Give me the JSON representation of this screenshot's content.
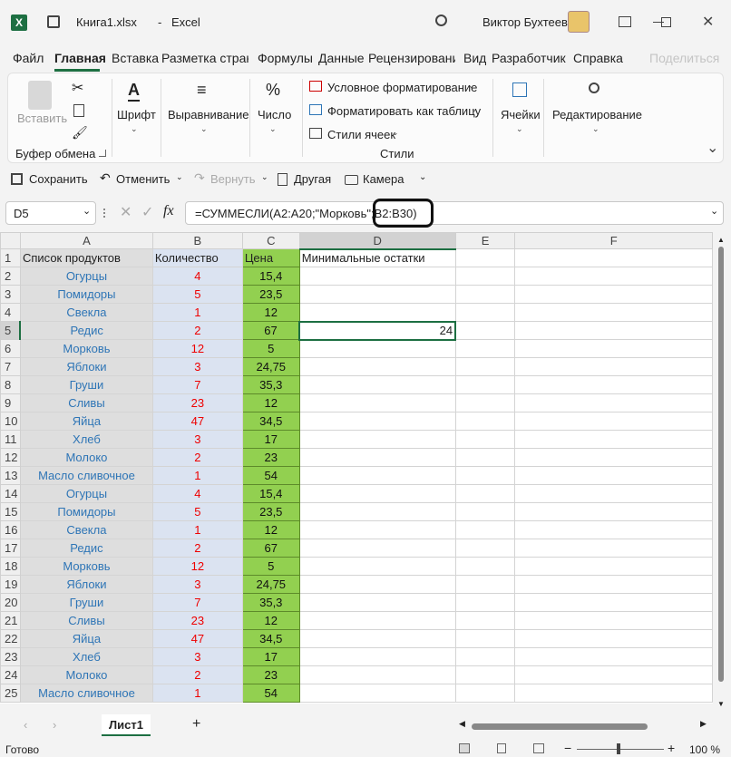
{
  "title": {
    "filename": "Книга1.xlsx",
    "separator": "-",
    "app": "Excel",
    "user": "Виктор Бухтеев"
  },
  "tabs": [
    "Файл",
    "Главная",
    "Вставка",
    "Разметка страни",
    "Формулы",
    "Данные",
    "Рецензировани",
    "Вид",
    "Разработчик",
    "Справка"
  ],
  "share_label": "Поделиться",
  "ribbon": {
    "paste": "Вставить",
    "clipboard": "Буфер обмена",
    "font": "Шрифт",
    "align": "Выравнивание",
    "number": "Число",
    "cond_format": "Условное форматирование",
    "format_table": "Форматировать как таблицу",
    "cell_styles": "Стили ячеек",
    "styles": "Стили",
    "cells": "Ячейки",
    "editing": "Редактирование"
  },
  "qat": {
    "save": "Сохранить",
    "undo": "Отменить",
    "redo": "Вернуть",
    "other": "Другая",
    "camera": "Камера"
  },
  "namebox": "D5",
  "formula": "=СУММЕСЛИ(A2:A20;\"Морковь\";B2:B30)",
  "columns": [
    "A",
    "B",
    "C",
    "D",
    "E",
    "F"
  ],
  "header_row": {
    "a": "Список продуктов",
    "b": "Количество",
    "c": "Цена",
    "d": "Минимальные остатки"
  },
  "rows": [
    [
      "Огурцы",
      "4",
      "15,4"
    ],
    [
      "Помидоры",
      "5",
      "23,5"
    ],
    [
      "Свекла",
      "1",
      "12"
    ],
    [
      "Редис",
      "2",
      "67"
    ],
    [
      "Морковь",
      "12",
      "5"
    ],
    [
      "Яблоки",
      "3",
      "24,75"
    ],
    [
      "Груши",
      "7",
      "35,3"
    ],
    [
      "Сливы",
      "23",
      "12"
    ],
    [
      "Яйца",
      "47",
      "34,5"
    ],
    [
      "Хлеб",
      "3",
      "17"
    ],
    [
      "Молоко",
      "2",
      "23"
    ],
    [
      "Масло сливочное",
      "1",
      "54"
    ],
    [
      "Огурцы",
      "4",
      "15,4"
    ],
    [
      "Помидоры",
      "5",
      "23,5"
    ],
    [
      "Свекла",
      "1",
      "12"
    ],
    [
      "Редис",
      "2",
      "67"
    ],
    [
      "Морковь",
      "12",
      "5"
    ],
    [
      "Яблоки",
      "3",
      "24,75"
    ],
    [
      "Груши",
      "7",
      "35,3"
    ],
    [
      "Сливы",
      "23",
      "12"
    ],
    [
      "Яйца",
      "47",
      "34,5"
    ],
    [
      "Хлеб",
      "3",
      "17"
    ],
    [
      "Молоко",
      "2",
      "23"
    ],
    [
      "Масло сливочное",
      "1",
      "54"
    ]
  ],
  "d5_value": "24",
  "sheet": "Лист1",
  "status": "Готово",
  "zoom": "100 %"
}
